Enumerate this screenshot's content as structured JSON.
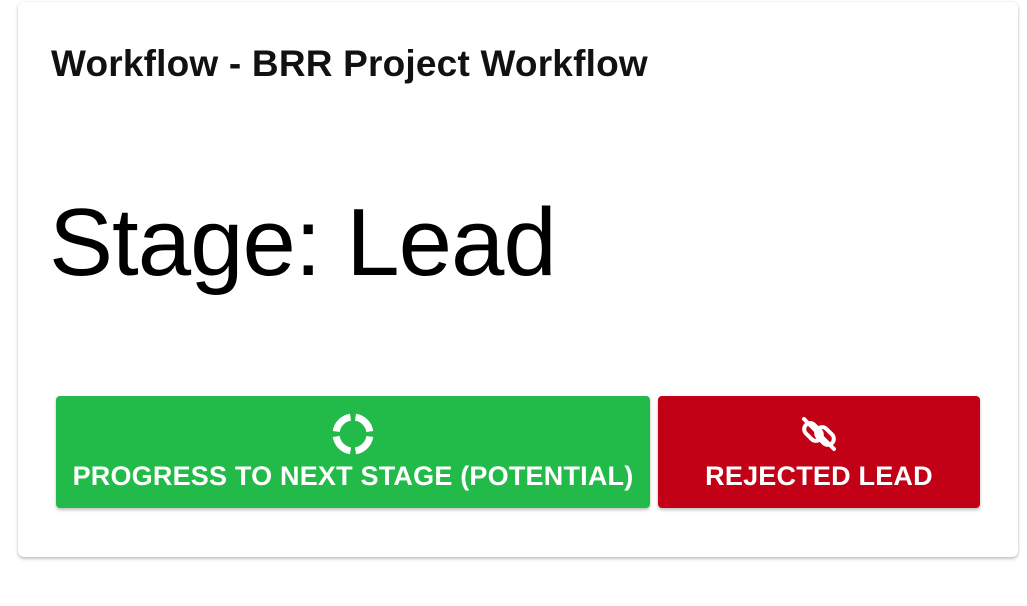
{
  "workflow": {
    "title": "Workflow - BRR Project Workflow",
    "stage_label": "Stage: Lead"
  },
  "actions": {
    "progress": {
      "label": "PROGRESS TO NEXT STAGE (POTENTIAL)",
      "icon": "progress-circle-icon",
      "color": "#22ba48"
    },
    "reject": {
      "label": "REJECTED LEAD",
      "icon": "link-off-icon",
      "color": "#c20016"
    }
  }
}
